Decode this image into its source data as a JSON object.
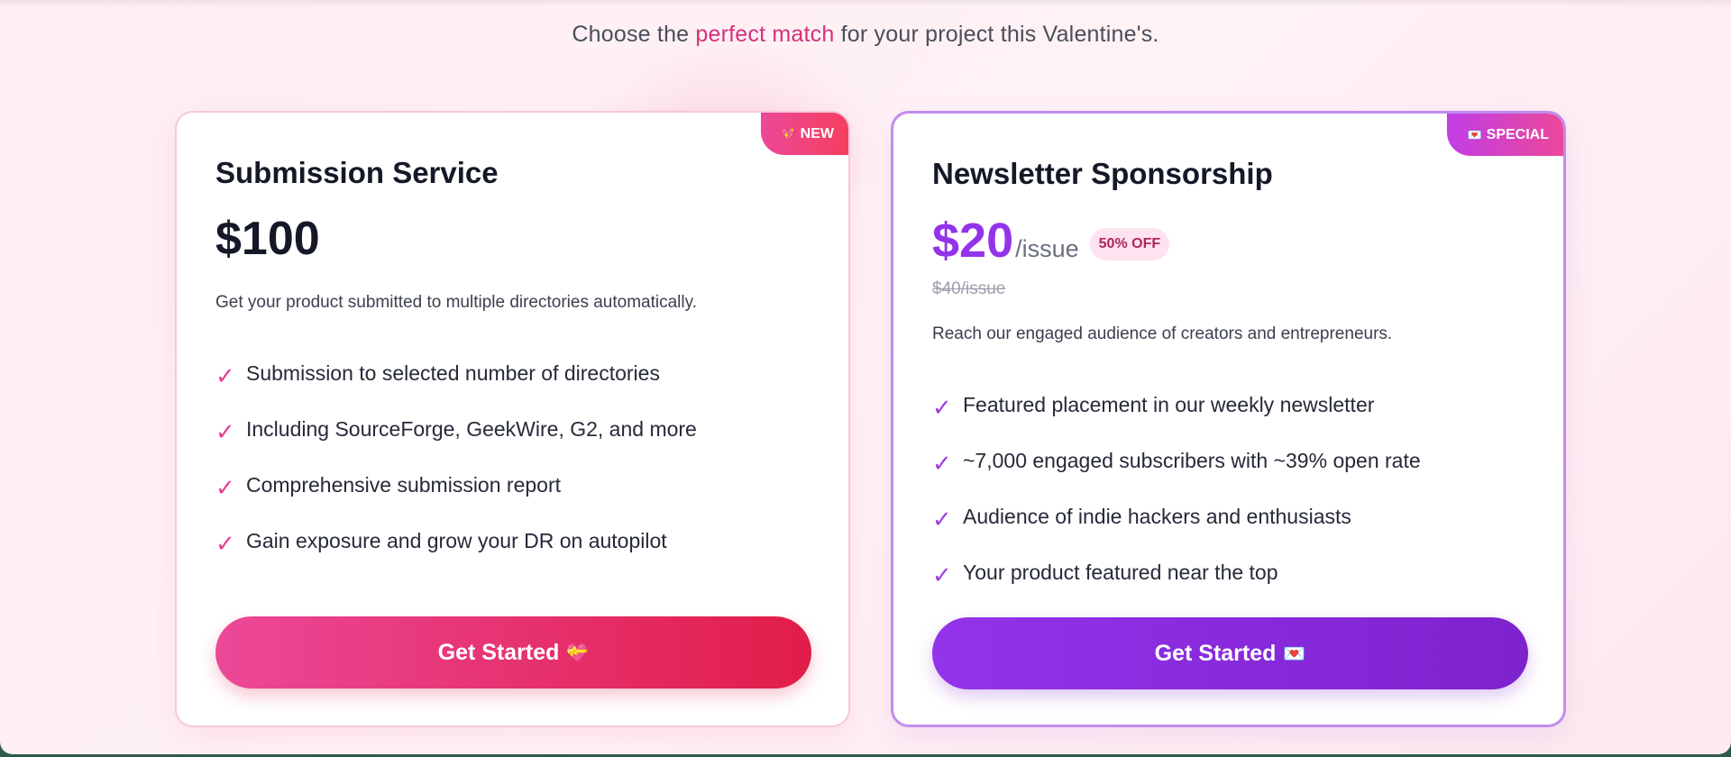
{
  "header": {
    "subtitle_pre": "Choose the ",
    "subtitle_highlight": "perfect match",
    "subtitle_post": " for your project this Valentine's."
  },
  "cards": [
    {
      "badge_icon": "💖",
      "badge_label": "NEW",
      "title": "Submission Service",
      "price": "$100",
      "description": "Get your product submitted to multiple directories automatically.",
      "features": [
        "Submission to selected number of directories",
        "Including SourceForge, GeekWire, G2, and more",
        "Comprehensive submission report",
        "Gain exposure and grow your DR on autopilot"
      ],
      "cta_label": "Get Started",
      "cta_icon": "💝",
      "accent_color": "#ec4899"
    },
    {
      "badge_icon": "💌",
      "badge_label": "SPECIAL",
      "title": "Newsletter Sponsorship",
      "price": "$20",
      "price_unit": "/issue",
      "discount_label": "50% OFF",
      "old_price": "$40/issue",
      "description": "Reach our engaged audience of creators and entrepreneurs.",
      "features": [
        "Featured placement in our weekly newsletter",
        "~7,000 engaged subscribers with ~39% open rate",
        "Audience of indie hackers and enthusiasts",
        "Your product featured near the top"
      ],
      "cta_label": "Get Started",
      "cta_icon": "💌",
      "accent_color": "#9333ea"
    }
  ],
  "check_icon": "✓",
  "icons": {
    "check": "check-icon",
    "badge_new": "sparkling-heart-icon",
    "badge_special": "love-letter-icon",
    "cta_1": "heart-gift-icon",
    "cta_2": "love-letter-icon"
  }
}
